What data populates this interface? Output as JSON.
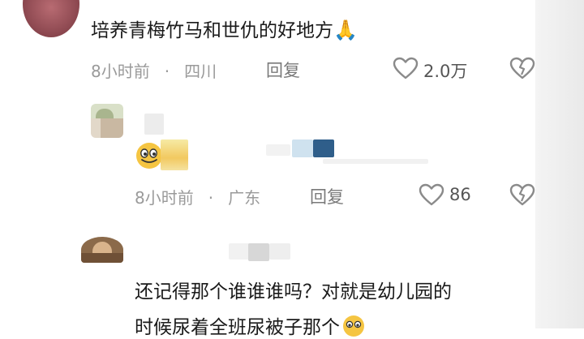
{
  "comments": [
    {
      "text": "培养青梅竹马和世仇的好地方",
      "emoji": "🙏",
      "time": "8小时前",
      "location": "四川",
      "reply_label": "回复",
      "like_count": "2.0万"
    },
    {
      "time": "8小时前",
      "location": "广东",
      "reply_label": "回复",
      "like_count": "86"
    },
    {
      "text_line1": "还记得那个谁谁谁吗？对就是幼儿园的",
      "text_line2": "时候尿着全班尿被子那个"
    }
  ],
  "colors": {
    "text": "#1a1a1a",
    "meta": "#9a9a9a",
    "emoji_yellow": "#f5c542"
  },
  "icons": [
    "heart-icon",
    "dislike-icon",
    "pray-emoji",
    "smile-emoji"
  ]
}
